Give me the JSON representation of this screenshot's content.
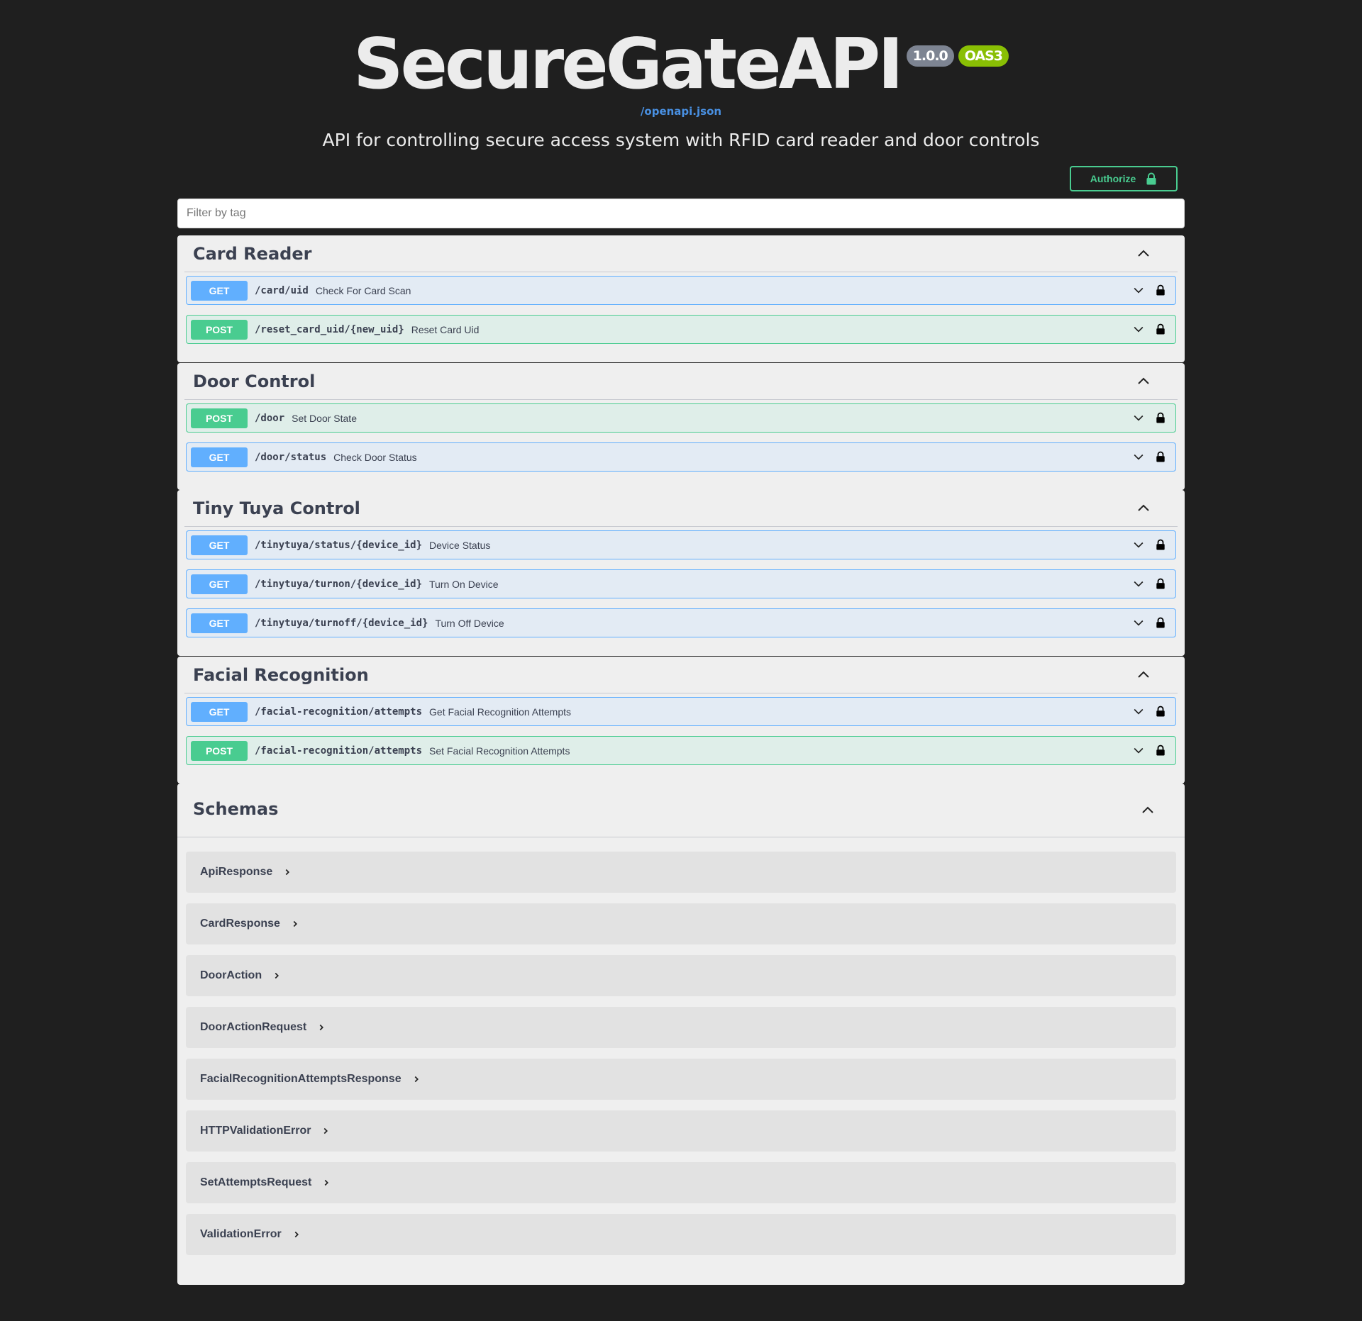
{
  "header": {
    "title": "SecureGateAPI",
    "version": "1.0.0",
    "oas": "OAS3",
    "spec_link": "/openapi.json",
    "description": "API for controlling secure access system with RFID card reader and door controls"
  },
  "authorize": {
    "label": "Authorize",
    "icon": "lock-icon"
  },
  "filter": {
    "placeholder": "Filter by tag",
    "value": ""
  },
  "colors": {
    "get": "#61affe",
    "post": "#49cc90",
    "authorize": "#49cc90",
    "oas_badge": "#89bf04"
  },
  "tags": [
    {
      "name": "Card Reader",
      "operations": [
        {
          "method": "GET",
          "path": "/card/uid",
          "summary": "Check For Card Scan"
        },
        {
          "method": "POST",
          "path": "/reset_card_uid/{new_uid}",
          "summary": "Reset Card Uid"
        }
      ]
    },
    {
      "name": "Door Control",
      "operations": [
        {
          "method": "POST",
          "path": "/door",
          "summary": "Set Door State"
        },
        {
          "method": "GET",
          "path": "/door/status",
          "summary": "Check Door Status"
        }
      ]
    },
    {
      "name": "Tiny Tuya Control",
      "operations": [
        {
          "method": "GET",
          "path": "/tinytuya/status/{device_id}",
          "summary": "Device Status"
        },
        {
          "method": "GET",
          "path": "/tinytuya/turnon/{device_id}",
          "summary": "Turn On Device"
        },
        {
          "method": "GET",
          "path": "/tinytuya/turnoff/{device_id}",
          "summary": "Turn Off Device"
        }
      ]
    },
    {
      "name": "Facial Recognition",
      "operations": [
        {
          "method": "GET",
          "path": "/facial-recognition/attempts",
          "summary": "Get Facial Recognition Attempts"
        },
        {
          "method": "POST",
          "path": "/facial-recognition/attempts",
          "summary": "Set Facial Recognition Attempts"
        }
      ]
    }
  ],
  "schemas": {
    "title": "Schemas",
    "models": [
      "ApiResponse",
      "CardResponse",
      "DoorAction",
      "DoorActionRequest",
      "FacialRecognitionAttemptsResponse",
      "HTTPValidationError",
      "SetAttemptsRequest",
      "ValidationError"
    ]
  }
}
